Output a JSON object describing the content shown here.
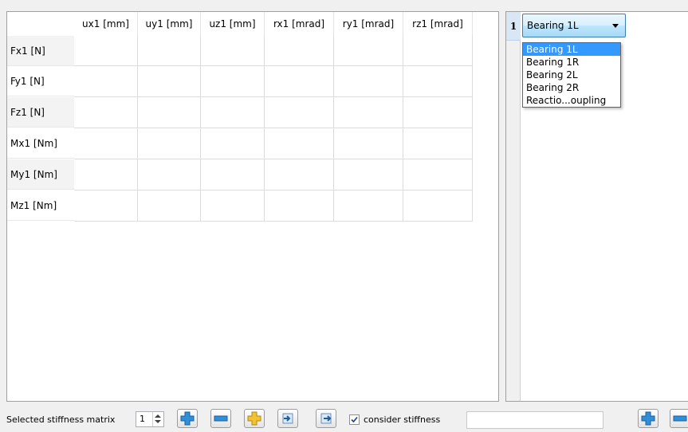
{
  "matrix": {
    "columns": [
      "ux1 [mm]",
      "uy1 [mm]",
      "uz1 [mm]",
      "rx1 [mrad]",
      "ry1 [mrad]",
      "rz1 [mrad]"
    ],
    "rows": [
      "Fx1 [N]",
      "Fy1 [N]",
      "Fz1 [N]",
      "Mx1 [Nm]",
      "My1 [Nm]",
      "Mz1 [Nm]"
    ]
  },
  "list": {
    "index": "1",
    "combo_value": "Bearing 1L",
    "options": [
      "Bearing 1L",
      "Bearing 1R",
      "Bearing 2L",
      "Bearing 2R",
      "Reactio...oupling"
    ],
    "selected_option": "Bearing 1L"
  },
  "toolbar": {
    "label": "Selected stiffness matrix",
    "spin_value": "1",
    "checkbox_label": "consider stiffness",
    "checkbox_checked": true,
    "text_value": ""
  },
  "icons": {
    "add": "plus-icon",
    "remove": "minus-icon",
    "copy_add": "plus-yellow-icon",
    "import": "import-arrow-icon",
    "export": "export-arrow-icon",
    "check": "checkmark-icon"
  },
  "colors": {
    "accent_blue": "#3399ff",
    "plus_blue": "#2f8fd8",
    "plus_yellow": "#f2c230"
  }
}
